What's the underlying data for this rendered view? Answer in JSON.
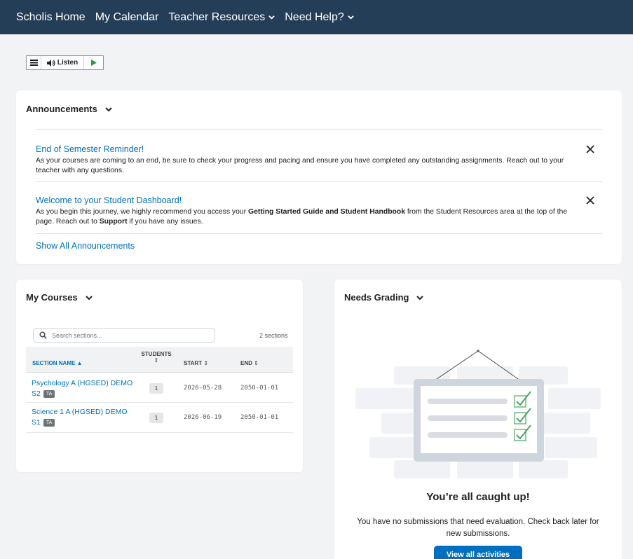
{
  "nav": {
    "items": [
      {
        "label": "Scholis Home",
        "dropdown": false
      },
      {
        "label": "My Calendar",
        "dropdown": false
      },
      {
        "label": "Teacher Resources",
        "dropdown": true
      },
      {
        "label": "Need Help?",
        "dropdown": true
      }
    ],
    "background": "#253e57"
  },
  "listen_toolbar": {
    "label": "Listen"
  },
  "announcements": {
    "title": "Announcements",
    "items": [
      {
        "title": "End of Semester Reminder!",
        "body": "As your courses are coming to an end, be sure to check your progress and pacing and ensure you have completed any outstanding assignments. Reach out to your teacher with any questions."
      },
      {
        "title": "Welcome to your Student Dashboard!",
        "body_parts": [
          "As you begin this journey, we highly recommend you access your ",
          "Getting Started Guide and Student Handbook",
          " from the Student Resources area at the top of the page. Reach out to ",
          "Support",
          " if you have any issues."
        ]
      }
    ],
    "show_all": "Show All Announcements"
  },
  "courses": {
    "title": "My Courses",
    "search_placeholder": "Search sections...",
    "count": "2 sections",
    "columns": {
      "name": "SECTION NAME",
      "students_line1": "STUDENTS",
      "start": "START",
      "end": "END"
    },
    "rows": [
      {
        "name": "Psychology A (HGSED) DEMO S2",
        "badge": "TA",
        "students": "1",
        "start": "2026-05-28",
        "end": "2050-01-01"
      },
      {
        "name": "Science 1 A (HGSED) DEMO S1",
        "badge": "TA",
        "students": "1",
        "start": "2026-06-19",
        "end": "2050-01-01"
      }
    ]
  },
  "grading": {
    "title": "Needs Grading",
    "caught_up": "You’re all caught up!",
    "message": "You have no submissions that need evaluation. Check back later for new submissions.",
    "button": "View all activities"
  },
  "colors": {
    "link": "#006fbf",
    "accent": "#006fbf",
    "check": "#46a661"
  }
}
